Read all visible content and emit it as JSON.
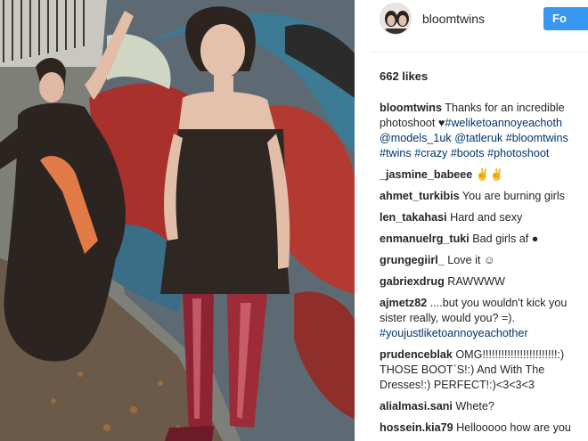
{
  "header": {
    "username": "bloomtwins",
    "follow_label": "Fo"
  },
  "likes": "662 likes",
  "caption": {
    "user": "bloomtwins",
    "text_1": "Thanks for an incredible",
    "text_2": "photoshoot",
    "heart": "♥",
    "tags_1": "#weliketoannoyeachoth",
    "tags_2": "@models_1uk @tatleruk #bloomtwins",
    "tags_3": "#twins #crazy #boots #photoshoot"
  },
  "comments": [
    {
      "user": "_jasmine_babeee",
      "text": "✌✌"
    },
    {
      "user": "ahmet_turkibis",
      "text": "You are burning girls"
    },
    {
      "user": "len_takahasi",
      "text": "Hard and sexy"
    },
    {
      "user": "enmanuelrg_tuki",
      "text": "Bad girls af ●"
    },
    {
      "user": "grungegiirl_",
      "text": "Love it ☺"
    },
    {
      "user": "gabriexdrug",
      "text": "RAWWWW"
    },
    {
      "user": "ajmetz82",
      "text": "....but you wouldn't kick you",
      "line2": "sister really, would you? =).",
      "tag": "#youjustliketoannoyeachother"
    },
    {
      "user": "prudenceblak",
      "text": "OMG!!!!!!!!!!!!!!!!!!!!!!!!:)",
      "line2": "THOSE BOOT`S!:) And With The",
      "line3": "Dresses!:) PERFECT!:)<3<3<3"
    },
    {
      "user": "alialmasi.sani",
      "text": "Whete?"
    },
    {
      "user": "hossein.kia79",
      "text": "Hellooooo how are you"
    }
  ],
  "colors": {
    "follow": "#3897f0",
    "hashtag": "#003569",
    "text": "#262626"
  }
}
